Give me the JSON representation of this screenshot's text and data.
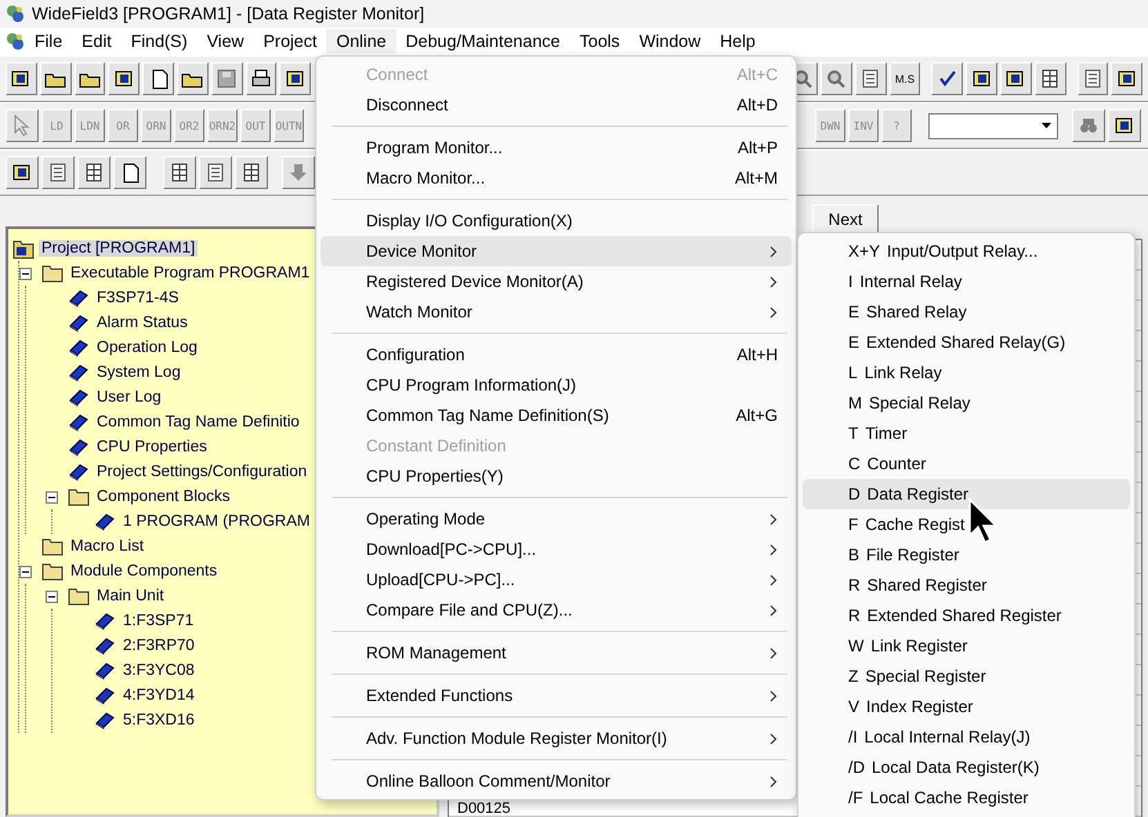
{
  "window": {
    "title": "WideField3 [PROGRAM1] - [Data Register Monitor]"
  },
  "menubar": [
    {
      "label": "File",
      "selected": false
    },
    {
      "label": "Edit",
      "selected": false
    },
    {
      "label": "Find(S)",
      "selected": false
    },
    {
      "label": "View",
      "selected": false
    },
    {
      "label": "Project",
      "selected": false
    },
    {
      "label": "Online",
      "selected": true
    },
    {
      "label": "Debug/Maintenance",
      "selected": false
    },
    {
      "label": "Tools",
      "selected": false
    },
    {
      "label": "Window",
      "selected": false
    },
    {
      "label": "Help",
      "selected": false
    }
  ],
  "toolbar": {
    "ms_label": "M.S",
    "ladder_left": [
      {
        "label": "LD",
        "disabled": true
      },
      {
        "label": "LDN",
        "disabled": true
      },
      {
        "label": "OR",
        "disabled": true
      },
      {
        "label": "ORN",
        "disabled": true
      },
      {
        "label": "OR2",
        "disabled": true
      },
      {
        "label": "ORN2",
        "disabled": true
      },
      {
        "label": "OUT",
        "disabled": true
      },
      {
        "label": "OUTN",
        "disabled": true
      }
    ],
    "ladder_right": [
      {
        "label": "DWN",
        "disabled": true
      },
      {
        "label": "INV",
        "disabled": true
      },
      {
        "label": "?",
        "disabled": true
      }
    ]
  },
  "tree": [
    {
      "label": "Project [PROGRAM1]",
      "kind": "project",
      "selected": true,
      "children": [
        {
          "label": "Executable Program PROGRAM1",
          "kind": "folder",
          "selected": false,
          "expanded": true,
          "children": [
            {
              "label": "F3SP71-4S",
              "kind": "leaf",
              "selected": false
            },
            {
              "label": "Alarm Status",
              "kind": "leaf",
              "selected": false
            },
            {
              "label": "Operation Log",
              "kind": "leaf",
              "selected": false
            },
            {
              "label": "System Log",
              "kind": "leaf",
              "selected": false
            },
            {
              "label": "User Log",
              "kind": "leaf",
              "selected": false
            },
            {
              "label": "Common Tag Name Definitio",
              "kind": "leaf",
              "selected": false
            },
            {
              "label": "CPU Properties",
              "kind": "leaf",
              "selected": false
            },
            {
              "label": "Project Settings/Configuration",
              "kind": "leaf",
              "selected": false
            },
            {
              "label": "Component Blocks",
              "kind": "folder",
              "selected": false,
              "expanded": true,
              "children": [
                {
                  "label": "1 PROGRAM (PROGRAM",
                  "kind": "leaf",
                  "selected": false
                }
              ]
            }
          ]
        },
        {
          "label": "Macro List",
          "kind": "folder",
          "selected": false
        },
        {
          "label": "Module Components",
          "kind": "folder",
          "selected": false,
          "expanded": true,
          "children": [
            {
              "label": "Main Unit",
              "kind": "folder",
              "selected": false,
              "expanded": true,
              "children": [
                {
                  "label": "1:F3SP71",
                  "kind": "leaf",
                  "selected": false
                },
                {
                  "label": "2:F3RP70",
                  "kind": "leaf",
                  "selected": false
                },
                {
                  "label": "3:F3YC08",
                  "kind": "leaf",
                  "selected": false
                },
                {
                  "label": "4:F3YD14",
                  "kind": "leaf",
                  "selected": false
                },
                {
                  "label": "5:F3XD16",
                  "kind": "leaf",
                  "selected": false
                }
              ]
            }
          ]
        }
      ]
    }
  ],
  "monitor": {
    "next_button": "Next",
    "row_label": "D00125"
  },
  "online_menu": [
    {
      "kind": "item",
      "label": "Connect",
      "shortcut": "Alt+C",
      "disabled": true,
      "submenu": false,
      "selected": false
    },
    {
      "kind": "item",
      "label": "Disconnect",
      "shortcut": "Alt+D",
      "disabled": false,
      "submenu": false,
      "selected": false
    },
    {
      "kind": "separator"
    },
    {
      "kind": "item",
      "label": "Program Monitor...",
      "shortcut": "Alt+P",
      "disabled": false,
      "submenu": false,
      "selected": false
    },
    {
      "kind": "item",
      "label": "Macro Monitor...",
      "shortcut": "Alt+M",
      "disabled": false,
      "submenu": false,
      "selected": false
    },
    {
      "kind": "separator"
    },
    {
      "kind": "item",
      "label": "Display I/O Configuration(X)",
      "disabled": false,
      "submenu": false,
      "selected": false
    },
    {
      "kind": "item",
      "label": "Device Monitor",
      "disabled": false,
      "submenu": true,
      "selected": true
    },
    {
      "kind": "item",
      "label": "Registered Device Monitor(A)",
      "disabled": false,
      "submenu": true,
      "selected": false
    },
    {
      "kind": "item",
      "label": "Watch Monitor",
      "disabled": false,
      "submenu": true,
      "selected": false
    },
    {
      "kind": "separator"
    },
    {
      "kind": "item",
      "label": "Configuration",
      "shortcut": "Alt+H",
      "disabled": false,
      "submenu": false,
      "selected": false
    },
    {
      "kind": "item",
      "label": "CPU Program Information(J)",
      "disabled": false,
      "submenu": false,
      "selected": false
    },
    {
      "kind": "item",
      "label": "Common Tag Name Definition(S)",
      "shortcut": "Alt+G",
      "disabled": false,
      "submenu": false,
      "selected": false
    },
    {
      "kind": "item",
      "label": "Constant Definition",
      "disabled": true,
      "submenu": false,
      "selected": false
    },
    {
      "kind": "item",
      "label": "CPU Properties(Y)",
      "disabled": false,
      "submenu": false,
      "selected": false
    },
    {
      "kind": "separator"
    },
    {
      "kind": "item",
      "label": "Operating Mode",
      "disabled": false,
      "submenu": true,
      "selected": false
    },
    {
      "kind": "item",
      "label": "Download[PC->CPU]...",
      "disabled": false,
      "submenu": true,
      "selected": false
    },
    {
      "kind": "item",
      "label": "Upload[CPU->PC]...",
      "disabled": false,
      "submenu": true,
      "selected": false
    },
    {
      "kind": "item",
      "label": "Compare File and CPU(Z)...",
      "disabled": false,
      "submenu": true,
      "selected": false
    },
    {
      "kind": "separator"
    },
    {
      "kind": "item",
      "label": "ROM Management",
      "disabled": false,
      "submenu": true,
      "selected": false
    },
    {
      "kind": "separator"
    },
    {
      "kind": "item",
      "label": "Extended Functions",
      "disabled": false,
      "submenu": true,
      "selected": false
    },
    {
      "kind": "separator"
    },
    {
      "kind": "item",
      "label": "Adv. Function Module Register Monitor(I)",
      "disabled": false,
      "submenu": true,
      "selected": false
    },
    {
      "kind": "separator"
    },
    {
      "kind": "item",
      "label": "Online Balloon Comment/Monitor",
      "disabled": false,
      "submenu": true,
      "selected": false
    }
  ],
  "device_submenu": [
    {
      "code": "X+Y",
      "label": "Input/Output Relay...",
      "selected": false
    },
    {
      "code": "I",
      "label": "Internal Relay",
      "selected": false
    },
    {
      "code": "E",
      "label": "Shared Relay",
      "selected": false
    },
    {
      "code": "E",
      "label": "Extended Shared Relay(G)",
      "selected": false
    },
    {
      "code": "L",
      "label": "Link Relay",
      "selected": false
    },
    {
      "code": "M",
      "label": "Special Relay",
      "selected": false
    },
    {
      "code": "T",
      "label": "Timer",
      "selected": false
    },
    {
      "code": "C",
      "label": "Counter",
      "selected": false
    },
    {
      "code": "D",
      "label": "Data Register",
      "selected": true
    },
    {
      "code": "F",
      "label": "Cache Regist",
      "selected": false
    },
    {
      "code": "B",
      "label": "File Register",
      "selected": false
    },
    {
      "code": "R",
      "label": "Shared Register",
      "selected": false
    },
    {
      "code": "R",
      "label": "Extended Shared Register",
      "selected": false
    },
    {
      "code": "W",
      "label": "Link Register",
      "selected": false
    },
    {
      "code": "Z",
      "label": "Special Register",
      "selected": false
    },
    {
      "code": "V",
      "label": "Index Register",
      "selected": false
    },
    {
      "code": "/I",
      "label": "Local Internal Relay(J)",
      "selected": false
    },
    {
      "code": "/D",
      "label": "Local Data Register(K)",
      "selected": false
    },
    {
      "code": "/F",
      "label": "Local Cache Register",
      "selected": false
    }
  ]
}
